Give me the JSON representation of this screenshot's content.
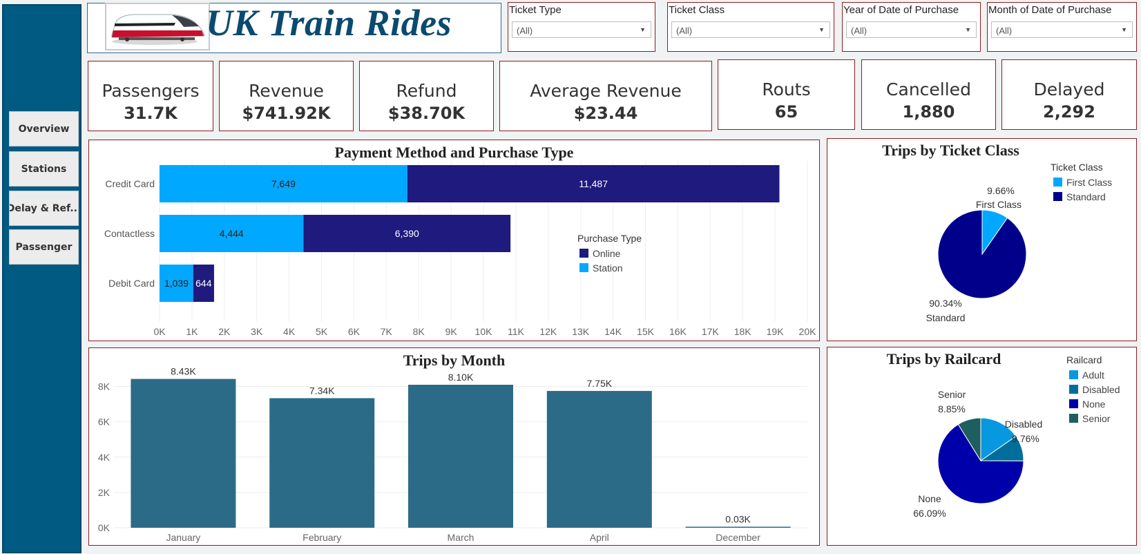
{
  "header": {
    "title": "UK Train Rides",
    "logo_icon": "train-icon"
  },
  "sidebar": {
    "items": [
      {
        "label": "Overview"
      },
      {
        "label": "Stations"
      },
      {
        "label": "Delay & Ref..."
      },
      {
        "label": "Passenger"
      }
    ]
  },
  "filters": [
    {
      "label": "Ticket Type",
      "value": "(All)"
    },
    {
      "label": "Ticket Class",
      "value": "(All)"
    },
    {
      "label": "Year of Date of Purchase",
      "value": "(All)"
    },
    {
      "label": "Month of Date of Purchase",
      "value": "(All)"
    }
  ],
  "kpis": [
    {
      "label": "Passengers",
      "value": "31.7K"
    },
    {
      "label": "Revenue",
      "value": "$741.92K"
    },
    {
      "label": "Refund",
      "value": "$38.70K"
    },
    {
      "label": "Average Revenue",
      "value": "$23.44"
    },
    {
      "label": "Routs",
      "value": "65"
    },
    {
      "label": "Cancelled",
      "value": "1,880"
    },
    {
      "label": "Delayed",
      "value": "2,292"
    }
  ],
  "colors": {
    "station": "#00a8ff",
    "online": "#1f1a7e",
    "month_bar": "#2c6b87",
    "first_class": "#00a8ff",
    "standard": "#00008b",
    "adult": "#0798e0",
    "disabled": "#006d9c",
    "none": "#0000aa",
    "senior": "#1f5e5e"
  },
  "chart_data": [
    {
      "type": "bar",
      "title": "Payment Method and Purchase Type",
      "orientation": "horizontal",
      "stacked": true,
      "categories": [
        "Credit Card",
        "Contactless",
        "Debit Card"
      ],
      "series": [
        {
          "name": "Station",
          "values": [
            7649,
            4444,
            1039
          ],
          "labels": [
            "7,649",
            "4,444",
            "1,039"
          ]
        },
        {
          "name": "Online",
          "values": [
            11487,
            6390,
            644
          ],
          "labels": [
            "11,487",
            "6,390",
            "644"
          ]
        }
      ],
      "xlim": [
        0,
        20000
      ],
      "xticks": [
        "0K",
        "1K",
        "2K",
        "3K",
        "4K",
        "5K",
        "6K",
        "7K",
        "8K",
        "9K",
        "10K",
        "11K",
        "12K",
        "13K",
        "14K",
        "15K",
        "16K",
        "17K",
        "18K",
        "19K",
        "20K"
      ],
      "legend": {
        "title": "Purchase Type",
        "items": [
          "Online",
          "Station"
        ],
        "placement": "right"
      }
    },
    {
      "type": "pie",
      "title": "Trips by Ticket Class",
      "slices": [
        {
          "name": "First Class",
          "pct": 9.66,
          "label": "9.66%"
        },
        {
          "name": "Standard",
          "pct": 90.34,
          "label": "90.34%"
        }
      ],
      "legend": {
        "title": "Ticket Class",
        "items": [
          "First Class",
          "Standard"
        ],
        "placement": "top-right"
      }
    },
    {
      "type": "bar",
      "title": "Trips by Month",
      "categories": [
        "January",
        "February",
        "March",
        "April",
        "December"
      ],
      "values": [
        8430,
        7340,
        8100,
        7750,
        30
      ],
      "labels": [
        "8.43K",
        "7.34K",
        "8.10K",
        "7.75K",
        "0.03K"
      ],
      "ylim": [
        0,
        9000
      ],
      "yticks": [
        "0K",
        "2K",
        "4K",
        "6K",
        "8K"
      ]
    },
    {
      "type": "pie",
      "title": "Trips by Railcard",
      "slices": [
        {
          "name": "Adult",
          "pct": 15.3,
          "label": ""
        },
        {
          "name": "Disabled",
          "pct": 9.76,
          "label": "9.76%"
        },
        {
          "name": "None",
          "pct": 66.09,
          "label": "66.09%"
        },
        {
          "name": "Senior",
          "pct": 8.85,
          "label": "8.85%"
        }
      ],
      "legend": {
        "title": "Railcard",
        "items": [
          "Adult",
          "Disabled",
          "None",
          "Senior"
        ],
        "placement": "top-right"
      }
    }
  ]
}
